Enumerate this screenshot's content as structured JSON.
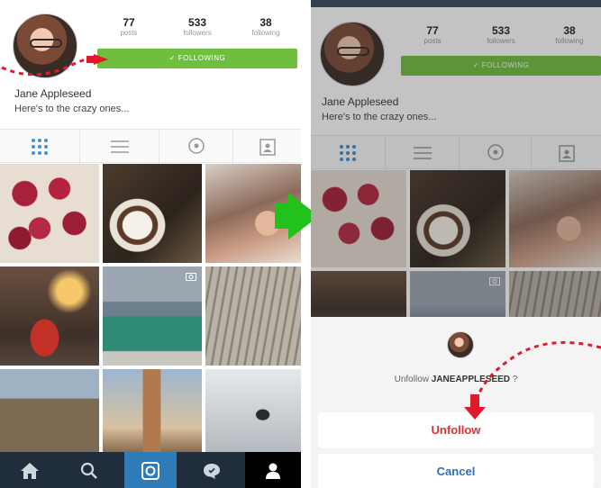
{
  "left_profile": {
    "stats": [
      {
        "num": "77",
        "label": "posts"
      },
      {
        "num": "533",
        "label": "followers"
      },
      {
        "num": "38",
        "label": "following"
      }
    ],
    "follow_button": "✓ FOLLOWING",
    "name": "Jane Appleseed",
    "bio": "Here's to the crazy ones..."
  },
  "right_profile": {
    "stats": [
      {
        "num": "77",
        "label": "posts"
      },
      {
        "num": "533",
        "label": "followers"
      },
      {
        "num": "38",
        "label": "following"
      }
    ],
    "follow_button": "✓ FOLLOWING",
    "name": "Jane Appleseed",
    "bio": "Here's to the crazy ones..."
  },
  "tabs": [
    "grid-icon",
    "list-icon",
    "location-pin-icon",
    "tagged-person-icon"
  ],
  "bottom_nav": [
    "home-icon",
    "search-icon",
    "camera-icon",
    "activity-bubble-icon",
    "profile-icon"
  ],
  "unfollow_sheet": {
    "prompt_prefix": "Unfollow ",
    "prompt_user": "JANEAPPLESEED",
    "prompt_suffix": " ?",
    "unfollow_label": "Unfollow",
    "cancel_label": "Cancel"
  },
  "colors": {
    "follow_green": "#6fbf3f",
    "arrow_red": "#e01a2b",
    "arrow_green": "#21c21c",
    "nav_dark": "#1f2d3d",
    "active_tab_blue": "#3b8fd6"
  }
}
